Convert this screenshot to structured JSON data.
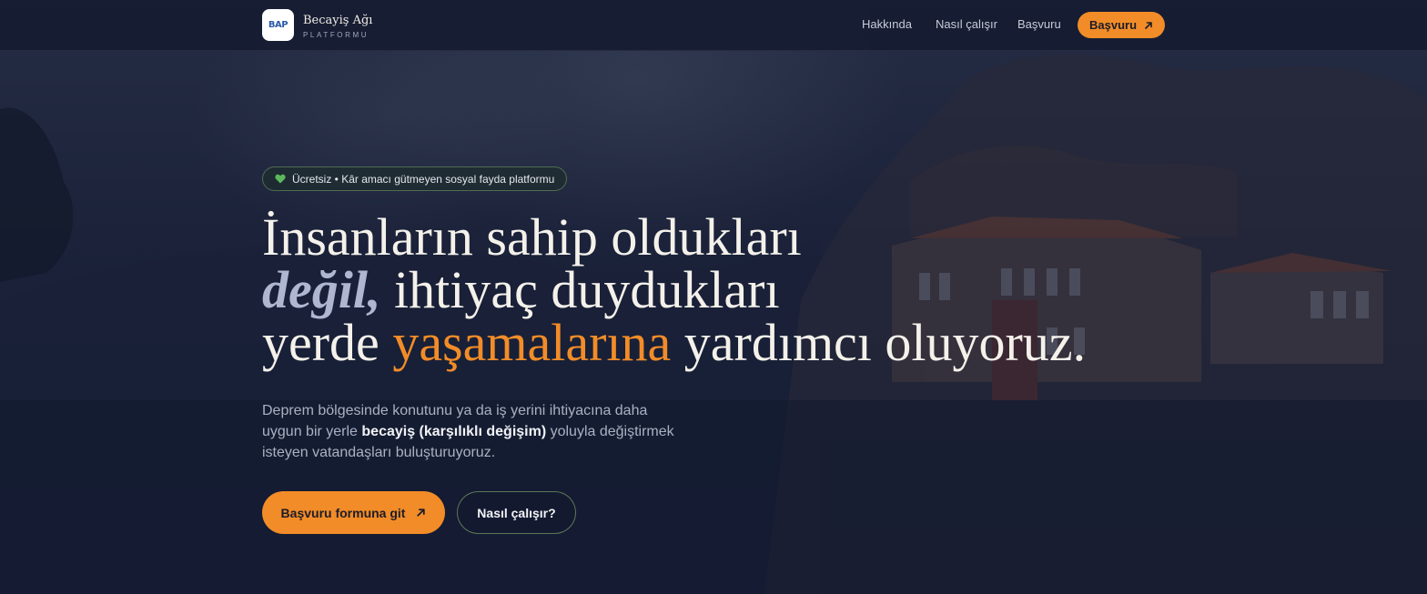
{
  "brand": {
    "logo_text": "BAP",
    "title": "Becayiş Ağı",
    "subtitle": "PLATFORMU"
  },
  "nav": {
    "links": [
      "Hakkında",
      "Nasıl çalışır",
      "Başvuru"
    ],
    "cta_label": "Başvuru"
  },
  "hero": {
    "badge": {
      "icon": "heart-icon",
      "text": "Ücretsiz • Kâr amacı gütmeyen sosyal fayda platformu"
    },
    "headline": {
      "line1": "İnsanların sahip oldukları",
      "line2_emphasis": "değil,",
      "line2_rest": " ihtiyaç duydukları",
      "line3_start": "yerde ",
      "line3_accent": "yaşamalarına",
      "line3_end": " yardımcı oluyoruz."
    },
    "lead": {
      "part1": "Deprem bölgesinde konutunu ya da iş yerini ihtiyacına daha uygun bir yerle ",
      "bold": "becayiş (karşılıklı değişim)",
      "part2": " yoluyla değiştirmek isteyen vatandaşları buluşturuyoruz."
    },
    "primary_button": "Başvuru formuna git",
    "secondary_button": "Nasıl çalışır?"
  },
  "colors": {
    "accent": "#f28c28",
    "background": "#171e36",
    "badge_icon": "#5cb85c"
  }
}
